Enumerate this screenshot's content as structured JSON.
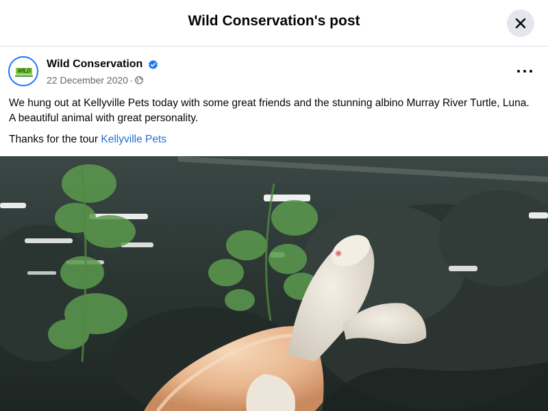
{
  "header": {
    "title": "Wild Conservation's post"
  },
  "post": {
    "author": "Wild Conservation",
    "avatar_text": "WILD",
    "date": "22 December 2020",
    "separator": "·",
    "text_paragraph1": "We hung out at Kellyville Pets today with some great friends and the stunning albino Murray River Turtle, Luna. A beautiful animal with great personality.",
    "text_paragraph2_prefix": "Thanks for the tour ",
    "mention": "Kellyville Pets",
    "photo_subject": "albino Murray River turtle swimming in aquarium"
  },
  "colors": {
    "link": "#216fdb",
    "verified": "#1877f2",
    "close_bg": "#e4e6eb"
  },
  "icons": [
    "close-icon",
    "verified-badge-icon",
    "globe-icon",
    "more-options-icon"
  ]
}
